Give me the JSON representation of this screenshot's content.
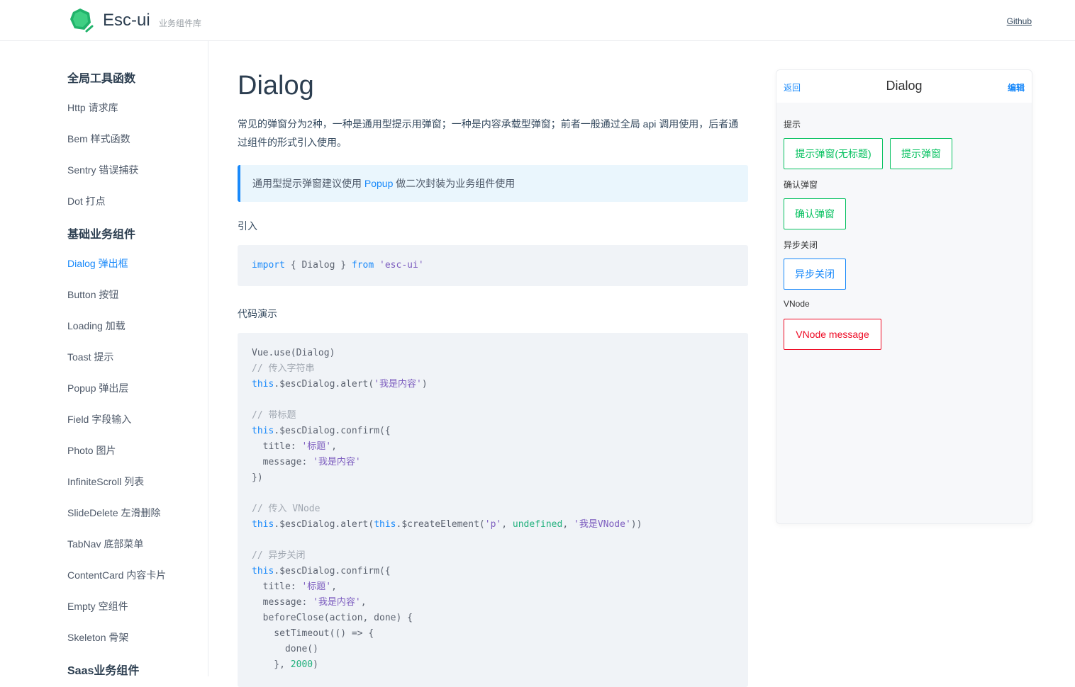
{
  "header": {
    "brand_name": "Esc-ui",
    "brand_sub": "业务组件库",
    "github": "Github",
    "accent": "#1989fa",
    "logo_color": "#21b36b"
  },
  "sidebar": {
    "groups": [
      {
        "title": "全局工具函数",
        "items": [
          "Http 请求库",
          "Bem 样式函数",
          "Sentry 错误捕获",
          "Dot 打点"
        ]
      },
      {
        "title": "基础业务组件",
        "items": [
          "Dialog 弹出框",
          "Button 按钮",
          "Loading 加载",
          "Toast 提示",
          "Popup 弹出层",
          "Field 字段输入",
          "Photo 图片",
          "InfiniteScroll 列表",
          "SlideDelete 左滑删除",
          "TabNav 底部菜单",
          "ContentCard 内容卡片",
          "Empty 空组件",
          "Skeleton 骨架"
        ]
      },
      {
        "title": "Saas业务组件",
        "items": []
      }
    ],
    "active_item": "Dialog 弹出框"
  },
  "main": {
    "title": "Dialog",
    "intro": "常见的弹窗分为2种，一种是通用型提示用弹窗；一种是内容承载型弹窗；前者一般通过全局 api 调用使用，后者通过组件的形式引入使用。",
    "tip_before": "通用型提示弹窗建议使用 ",
    "tip_link": "Popup",
    "tip_after": " 做二次封装为业务组件使用",
    "import_label": "引入",
    "demo_label": "代码演示"
  },
  "simulator": {
    "back": "返回",
    "title": "Dialog",
    "edit": "编辑",
    "sections": [
      {
        "label": "提示",
        "buttons": [
          "提示弹窗(无标题)",
          "提示弹窗"
        ]
      },
      {
        "label": "确认弹窗",
        "buttons": [
          "确认弹窗"
        ]
      },
      {
        "label": "异步关闭",
        "buttons": [
          "异步关闭"
        ]
      },
      {
        "label": "VNode",
        "buttons": [
          "VNode message"
        ]
      }
    ]
  }
}
